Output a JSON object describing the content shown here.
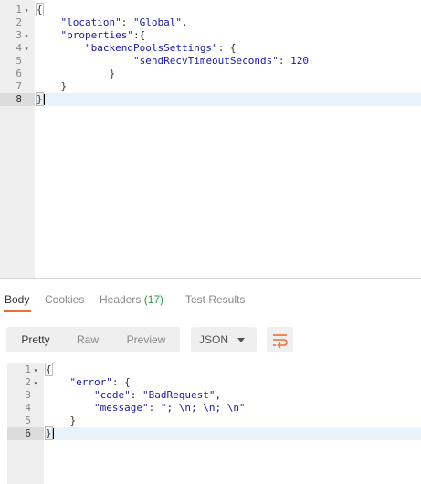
{
  "request_editor": {
    "lines": [
      {
        "num": "1",
        "fold": "▾"
      },
      {
        "num": "2",
        "fold": ""
      },
      {
        "num": "3",
        "fold": "▾"
      },
      {
        "num": "4",
        "fold": "▾"
      },
      {
        "num": "5",
        "fold": ""
      },
      {
        "num": "6",
        "fold": ""
      },
      {
        "num": "7",
        "fold": ""
      },
      {
        "num": "8",
        "fold": ""
      }
    ],
    "open_brace": "{",
    "close_brace": "}",
    "location_key": "\"location\"",
    "location_value": "\"Global\"",
    "properties_key": "\"properties\"",
    "backend_key": "\"backendPoolsSettings\"",
    "timeout_key": "\"sendRecvTimeoutSeconds\"",
    "timeout_value": "120"
  },
  "response_tabs": {
    "body": "Body",
    "cookies": "Cookies",
    "headers": "Headers",
    "headers_count": "(17)",
    "test_results": "Test Results"
  },
  "view_modes": {
    "pretty": "Pretty",
    "raw": "Raw",
    "preview": "Preview"
  },
  "format_select": {
    "selected": "JSON"
  },
  "response_editor": {
    "lines": [
      {
        "num": "1",
        "fold": "▾"
      },
      {
        "num": "2",
        "fold": "▾"
      },
      {
        "num": "3",
        "fold": ""
      },
      {
        "num": "4",
        "fold": ""
      },
      {
        "num": "5",
        "fold": ""
      },
      {
        "num": "6",
        "fold": ""
      }
    ],
    "error_key": "\"error\"",
    "code_key": "\"code\"",
    "code_value": "\"BadRequest\"",
    "message_key": "\"message\"",
    "message_value": "\"; \\n; \\n; \\n\""
  },
  "colors": {
    "accent": "#f26b3a",
    "count_green": "#2e9c44",
    "string_blue": "#1a1aa6",
    "active_line": "#e8f2fb"
  },
  "icons": {
    "wrap": "wrap-lines-icon",
    "caret": "chevron-down-icon"
  }
}
